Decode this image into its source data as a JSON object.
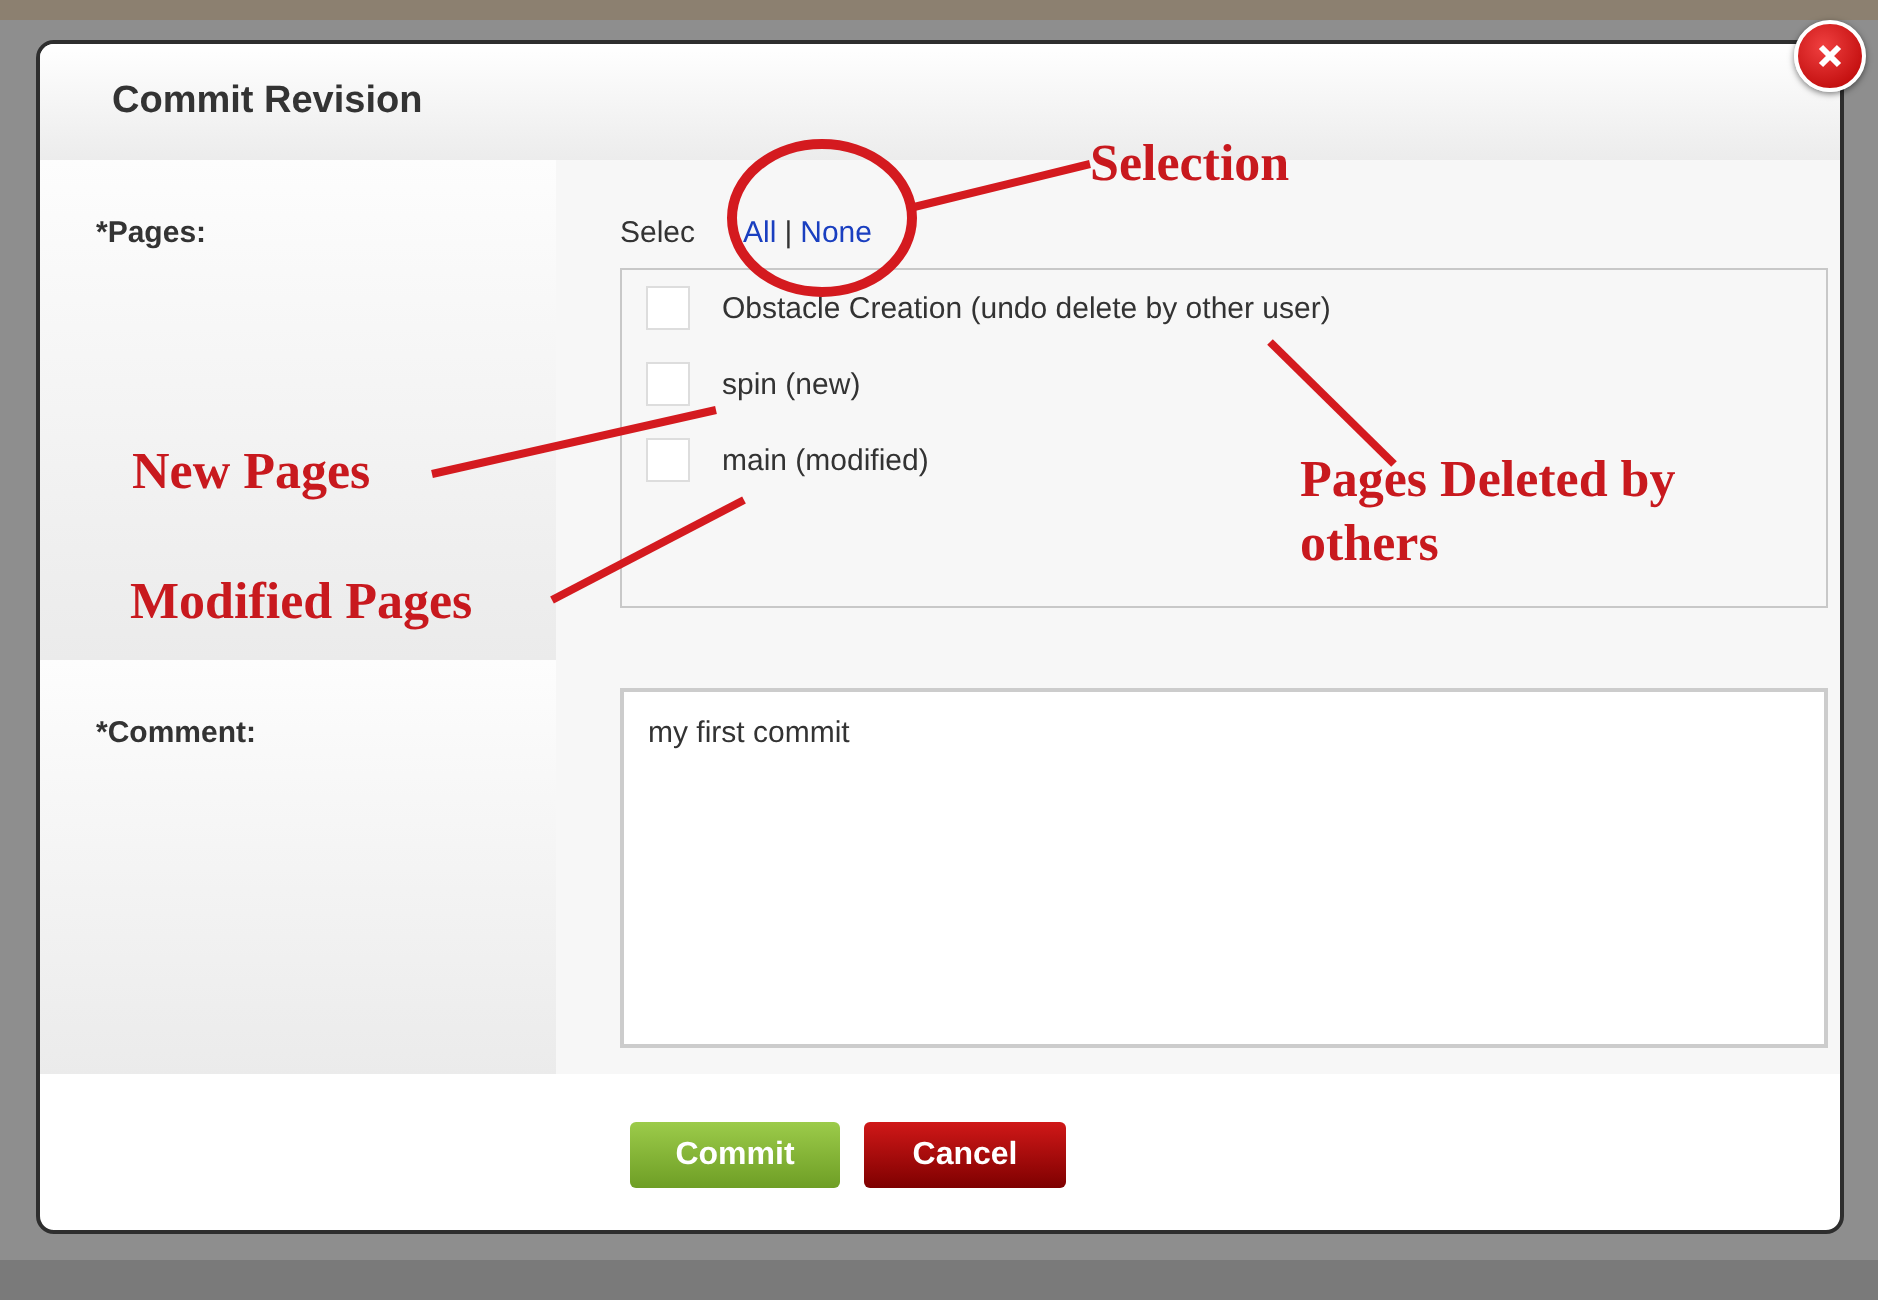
{
  "dialog": {
    "title": "Commit Revision",
    "pages": {
      "label": "*Pages:",
      "select_prefix": "Selec",
      "select_all": "All",
      "separator": "|",
      "select_none": "None",
      "items": [
        {
          "label": "Obstacle Creation (undo delete by other user)",
          "checked": false
        },
        {
          "label": "spin (new)",
          "checked": false
        },
        {
          "label": "main (modified)",
          "checked": false
        }
      ]
    },
    "comment": {
      "label": "*Comment:",
      "value": "my first commit"
    },
    "buttons": [
      {
        "kind": "primary",
        "label": "Commit"
      },
      {
        "kind": "danger",
        "label": "Cancel"
      }
    ]
  },
  "annotations": [
    {
      "text": "Selection"
    },
    {
      "text": "New Pages"
    },
    {
      "text": "Modified Pages"
    },
    {
      "text": "Pages Deleted by others"
    }
  ]
}
